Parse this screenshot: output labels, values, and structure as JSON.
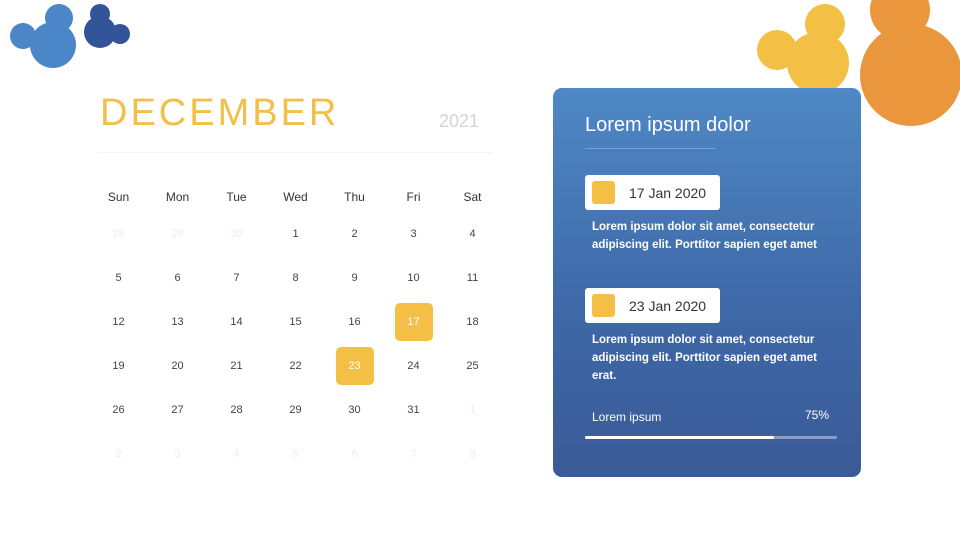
{
  "calendar": {
    "month": "DECEMBER",
    "year": "2021",
    "weekdays": [
      "Sun",
      "Mon",
      "Tue",
      "Wed",
      "Thu",
      "Fri",
      "Sat"
    ],
    "weeks": [
      [
        {
          "d": "28",
          "muted": true
        },
        {
          "d": "29",
          "muted": true
        },
        {
          "d": "30",
          "muted": true
        },
        {
          "d": "1"
        },
        {
          "d": "2"
        },
        {
          "d": "3"
        },
        {
          "d": "4"
        }
      ],
      [
        {
          "d": "5"
        },
        {
          "d": "6"
        },
        {
          "d": "7"
        },
        {
          "d": "8"
        },
        {
          "d": "9"
        },
        {
          "d": "10"
        },
        {
          "d": "11"
        }
      ],
      [
        {
          "d": "12"
        },
        {
          "d": "13"
        },
        {
          "d": "14"
        },
        {
          "d": "15"
        },
        {
          "d": "16"
        },
        {
          "d": "17",
          "highlight": true
        },
        {
          "d": "18"
        }
      ],
      [
        {
          "d": "19"
        },
        {
          "d": "20"
        },
        {
          "d": "21"
        },
        {
          "d": "22"
        },
        {
          "d": "23",
          "highlight": true
        },
        {
          "d": "24"
        },
        {
          "d": "25"
        }
      ],
      [
        {
          "d": "26"
        },
        {
          "d": "27"
        },
        {
          "d": "28"
        },
        {
          "d": "29"
        },
        {
          "d": "30"
        },
        {
          "d": "31"
        },
        {
          "d": "1",
          "muted": true
        }
      ],
      [
        {
          "d": "2",
          "muted": true
        },
        {
          "d": "3",
          "muted": true
        },
        {
          "d": "4",
          "muted": true
        },
        {
          "d": "5",
          "muted": true
        },
        {
          "d": "6",
          "muted": true
        },
        {
          "d": "7",
          "muted": true
        },
        {
          "d": "8",
          "muted": true
        }
      ]
    ]
  },
  "panel": {
    "title": "Lorem ipsum dolor",
    "events": [
      {
        "date": "17 Jan 2020",
        "description": "Lorem ipsum dolor sit amet, consectetur adipiscing elit. Porttitor sapien eget amet"
      },
      {
        "date": "23 Jan 2020",
        "description": "Lorem ipsum dolor sit amet, consectetur adipiscing elit. Porttitor sapien eget amet erat."
      }
    ],
    "progress": {
      "label": "Lorem ipsum",
      "value_text": "75%",
      "fraction": 0.75
    }
  },
  "colors": {
    "accent_yellow": "#f3bf45",
    "accent_orange": "#ea963c",
    "panel_blue": "#4a7cbd",
    "dark_blue": "#3a5a97",
    "light_blue": "#4a86c8"
  }
}
